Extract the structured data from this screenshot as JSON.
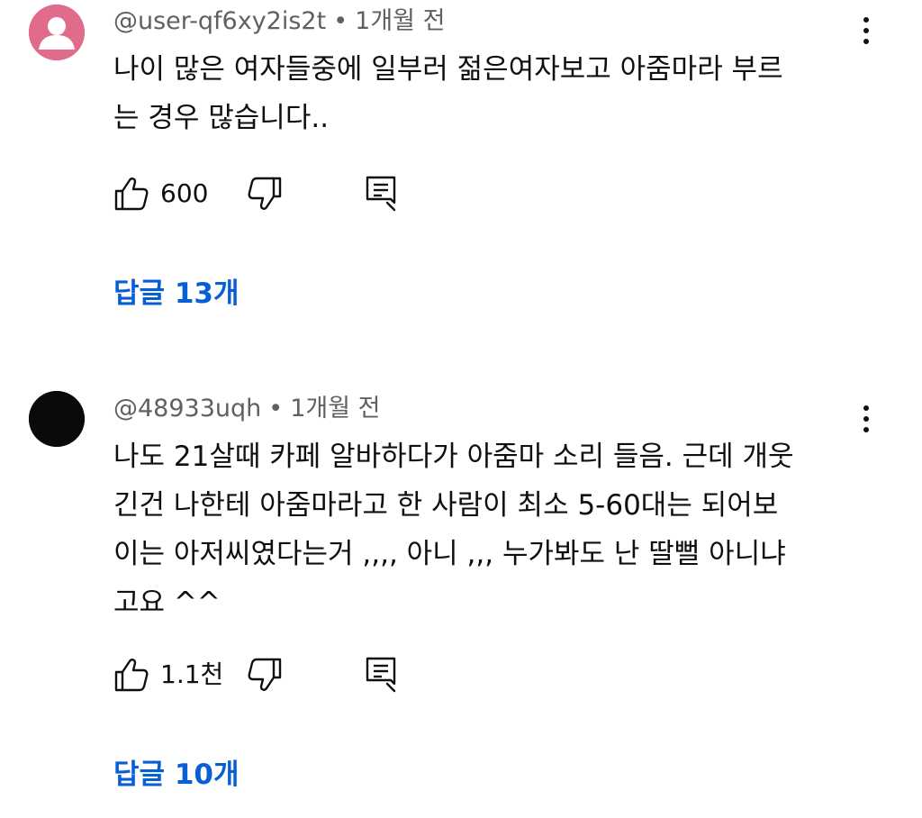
{
  "comments": [
    {
      "author": "@user-qf6xy2is2t",
      "separator": "•",
      "time": "1개월 전",
      "avatar_color": "#e06b8b",
      "avatar_icon": "person-silhouette-icon",
      "lines": [
        "나이 많은 여자들중에 일부러 젊은여자보고 아줌마라 부르",
        "는 경우 많습니다.."
      ],
      "likes": "600",
      "replies_label": "답글 13개"
    },
    {
      "author": "@48933uqh",
      "separator": "•",
      "time": "1개월 전",
      "avatar_color": "#0a0a0a",
      "avatar_icon": "solid-avatar",
      "lines": [
        "나도 21살때 카페 알바하다가 아줌마 소리 들음. 근데 개웃",
        "긴건 나한테 아줌마라고 한 사람이 최소 5-60대는 되어보",
        "이는 아저씨였다는거 ,,,, 아니 ,,, 누가봐도 난 딸뻘 아니냐",
        "고요 ^^"
      ],
      "likes": "1.1천",
      "replies_label": "답글 10개"
    }
  ],
  "colors": {
    "text": "#0f0f0f",
    "meta": "#606060",
    "link": "#065fd4",
    "background": "#ffffff"
  }
}
